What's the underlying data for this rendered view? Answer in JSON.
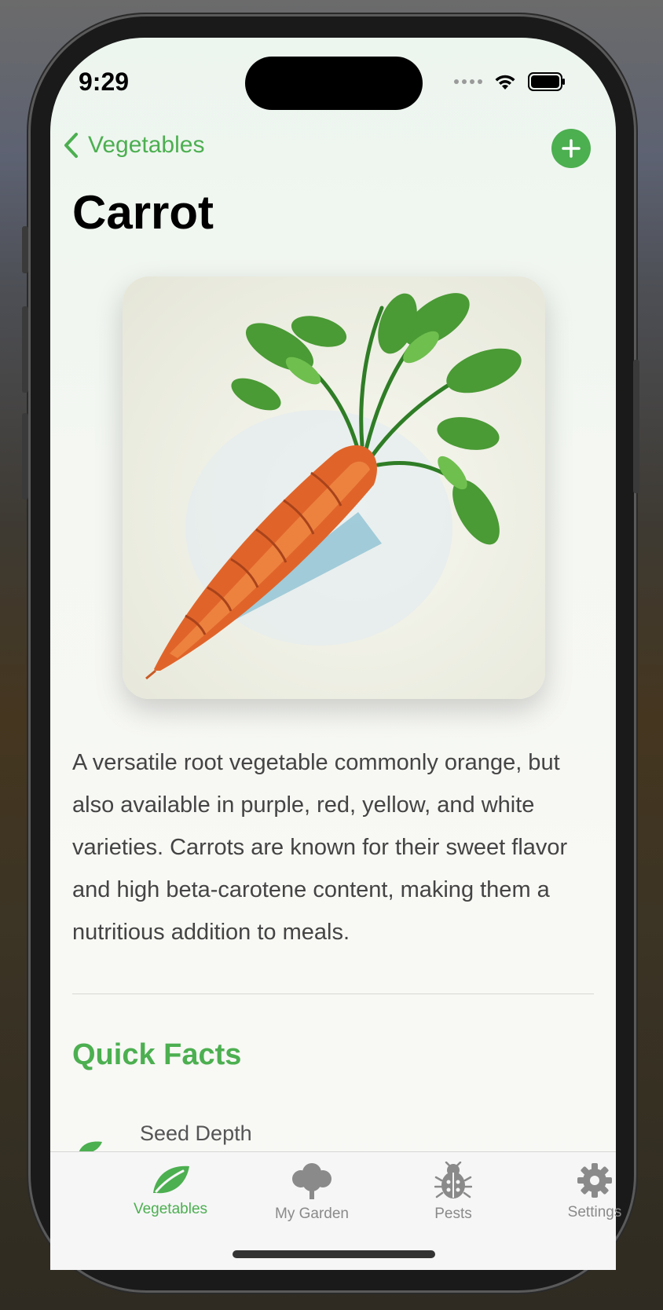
{
  "status_bar": {
    "time": "9:29"
  },
  "nav": {
    "back_label": "Vegetables",
    "add_icon": "plus-icon"
  },
  "page": {
    "title": "Carrot"
  },
  "hero_image": {
    "subject": "carrot"
  },
  "description": "A versatile root vegetable commonly orange, but also available in purple, red, yellow, and white varieties. Carrots are known for their sweet flavor and high beta-carotene content, making them a nutritious addition to meals.",
  "quick_facts": {
    "title": "Quick Facts",
    "items": [
      {
        "label": "Seed Depth",
        "icon": "leaf-icon"
      }
    ]
  },
  "tabs": [
    {
      "label": "Vegetables",
      "icon": "leaf-icon",
      "active": true
    },
    {
      "label": "My Garden",
      "icon": "tree-icon",
      "active": false
    },
    {
      "label": "Pests",
      "icon": "bug-icon",
      "active": false
    },
    {
      "label": "Settings",
      "icon": "gear-icon",
      "active": false
    }
  ],
  "colors": {
    "accent": "#4caf50",
    "text": "#000000",
    "secondary_text": "#444444",
    "inactive_tab": "#8a8a8a"
  }
}
